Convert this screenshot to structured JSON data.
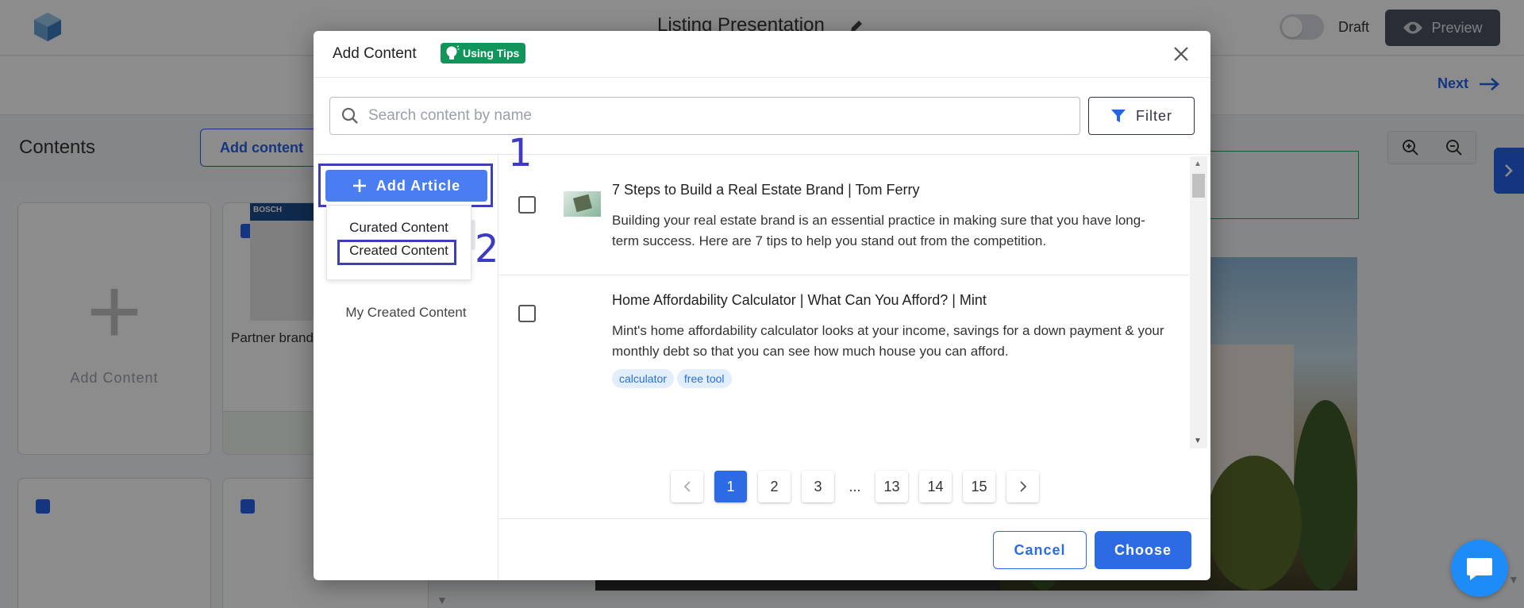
{
  "app": {
    "document_title": "Listing Presentation",
    "draft_label": "Draft",
    "preview_label": "Preview",
    "next_label": "Next"
  },
  "contents_panel": {
    "title": "Contents",
    "add_content_button": "Add content",
    "add_card_label": "Add Content",
    "partner_card_label": "Partner brand",
    "partner_thumb_brand": "BOSCH"
  },
  "modal": {
    "title": "Add Content",
    "tips_label": "Using Tips",
    "search_placeholder": "Search content by name",
    "filter_label": "Filter",
    "add_article_label": "Add Article",
    "dropdown_items": [
      "Curated Content",
      "Created Content"
    ],
    "my_created_label": "My Created Content",
    "step_labels": [
      "1",
      "2"
    ],
    "items": [
      {
        "title": "7 Steps to Build a Real Estate Brand | Tom Ferry",
        "description": "Building your real estate brand is an essential practice in making sure that you have long-term success. Here are 7 tips to help you stand out from the competition.",
        "tags": []
      },
      {
        "title": "Home Affordability Calculator | What Can You Afford? | Mint",
        "description": "Mint's home affordability calculator looks at your income, savings for a down payment & your monthly debt so that you can see how much house you can afford.",
        "tags": [
          "calculator",
          "free tool"
        ]
      }
    ],
    "pagination": [
      "1",
      "2",
      "3",
      "...",
      "13",
      "14",
      "15"
    ],
    "current_page": "1",
    "cancel_label": "Cancel",
    "choose_label": "Choose"
  },
  "colors": {
    "primary": "#2d6be4",
    "tips_green": "#12955a",
    "annotation": "#3f3fb5"
  }
}
